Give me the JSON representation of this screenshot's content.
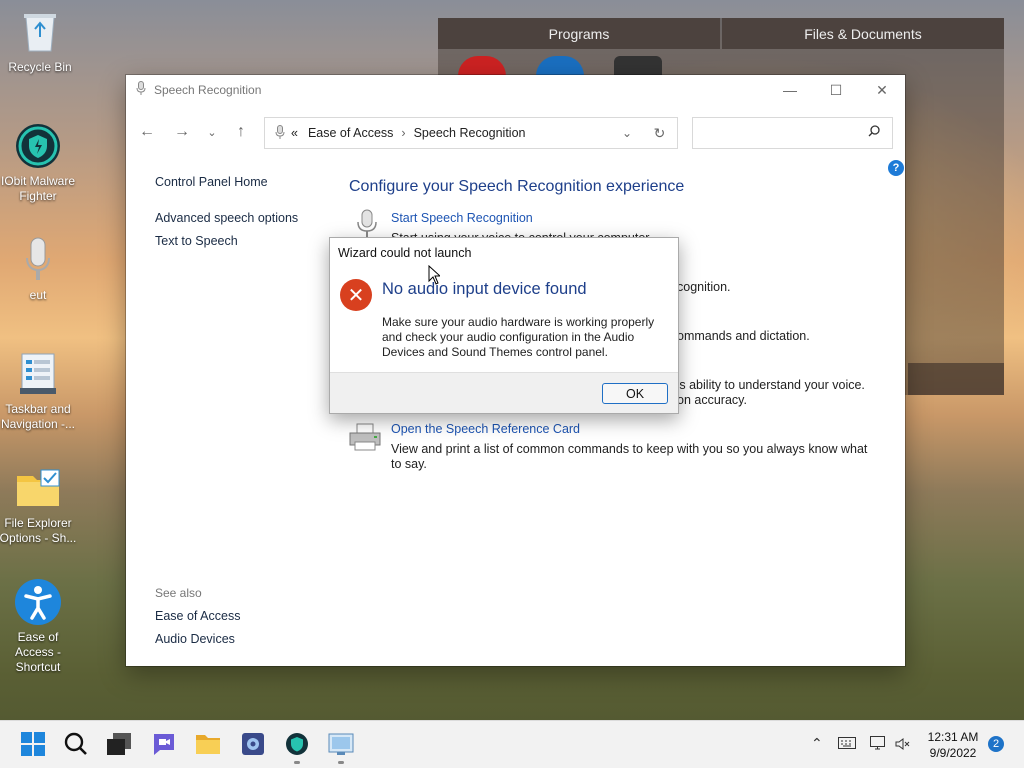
{
  "desktop": {
    "icons": [
      {
        "label": "Recycle Bin",
        "icon": "recycle-bin-icon"
      },
      {
        "label": "IObit Malware Fighter",
        "icon": "iobit-shield-icon"
      },
      {
        "label": "eut",
        "icon": "microphone-icon"
      },
      {
        "label": "Taskbar and Navigation -...",
        "icon": "taskbar-settings-icon"
      },
      {
        "label": "File Explorer Options - Sh...",
        "icon": "folder-check-icon"
      },
      {
        "label": "Ease of Access - Shortcut",
        "icon": "accessibility-icon"
      }
    ]
  },
  "launcher": {
    "tabs": [
      "Programs",
      "Files & Documents"
    ]
  },
  "window": {
    "title": "Speech Recognition",
    "address": {
      "chevrons": "«",
      "crumbs": [
        "Ease of Access",
        "Speech Recognition"
      ],
      "separator": "›"
    },
    "search_placeholder": "",
    "sidebar": {
      "home": "Control Panel Home",
      "links": [
        "Advanced speech options",
        "Text to Speech"
      ],
      "see_also_heading": "See also",
      "see_also": [
        "Ease of Access",
        "Audio Devices"
      ]
    },
    "heading": "Configure your Speech Recognition experience",
    "tasks": [
      {
        "link": "Start Speech Recognition",
        "desc": "Start using your voice to control your computer."
      },
      {
        "link": "",
        "desc": "cognition."
      },
      {
        "link": "",
        "desc": "ommands and dictation."
      },
      {
        "link": "",
        "desc": "'s ability to understand your voice.\non accuracy."
      },
      {
        "link": "Open the Speech Reference Card",
        "desc": "View and print a list of common commands to keep with you so you always know what to say."
      }
    ]
  },
  "dialog": {
    "title": "Wizard could not launch",
    "main_instruction": "No audio input device found",
    "content": "Make sure your audio hardware is working properly and check your audio configuration in the Audio Devices and Sound Themes control panel.",
    "ok_label": "OK"
  },
  "taskbar": {
    "apps": [
      "start-icon",
      "search-icon",
      "task-view-icon",
      "chat-icon",
      "file-explorer-icon",
      "control-panel-app-icon",
      "iobit-taskbar-icon",
      "speech-taskbar-icon"
    ],
    "clock_time": "12:31 AM",
    "clock_date": "9/9/2022",
    "notification_count": "2"
  },
  "colors": {
    "accent": "#1e73c8",
    "link": "#1e55b3",
    "heading": "#1e3f8a",
    "error": "#d8401f"
  }
}
